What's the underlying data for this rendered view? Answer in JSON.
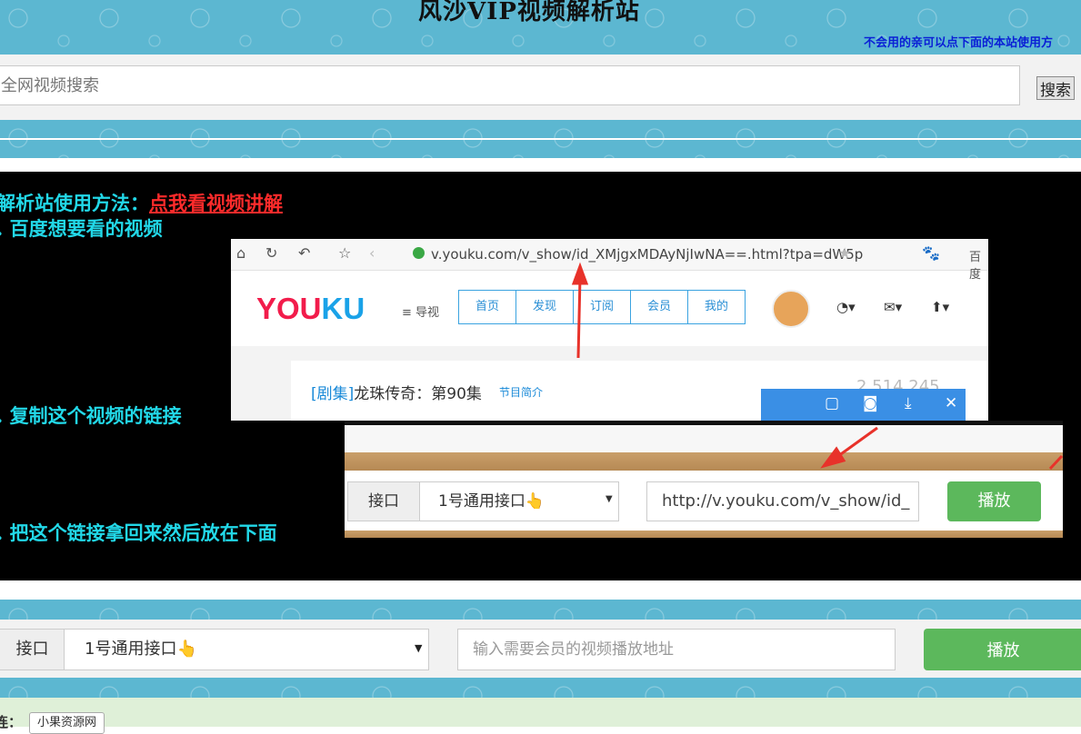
{
  "header": {
    "site_title": "风沙VIP视频解析站",
    "usage_tip": "不会用的亲可以点下面的本站使用方"
  },
  "search": {
    "placeholder": "全网视频搜索",
    "button_label": "搜索"
  },
  "guide": {
    "heading": "解析站使用方法：",
    "heading_link": "点我看视频讲解",
    "step1": ". 百度想要看的视频",
    "step2": ". 复制这个视频的链接",
    "step3": ". 把这个链接拿回来然后放在下面"
  },
  "browser_screenshot": {
    "url": "v.youku.com/v_show/id_XMjgxMDAyNjIwNA==.html?tpa=dW5p",
    "search_engine": "百度",
    "logo_parts": [
      "YOU",
      "KU"
    ],
    "nav_guide": "≡ 导视",
    "tabs": [
      "首页",
      "发现",
      "订阅",
      "会员",
      "我的"
    ],
    "video_tag": "[剧集]",
    "video_title": "龙珠传奇：第90集",
    "video_intro": "节目简介",
    "play_count": "2,514,245"
  },
  "play_screenshot": {
    "label": "接口",
    "selected": "1号通用接口👆",
    "url": "http://v.youku.com/v_show/id_",
    "play_label": "播放"
  },
  "player": {
    "api_label": "接口",
    "api_selected": "1号通用接口👆",
    "url_placeholder": "输入需要会员的视频播放地址",
    "play_label": "播放"
  },
  "footer": {
    "friend_label": "连：",
    "friend_link": "小果资源网"
  },
  "colors": {
    "banner": "#5cb7d1",
    "guide_text": "#22d8e8",
    "guide_link": "#ff2b2b",
    "play_green": "#5cb85c",
    "footer_bg": "#dff0d8"
  }
}
